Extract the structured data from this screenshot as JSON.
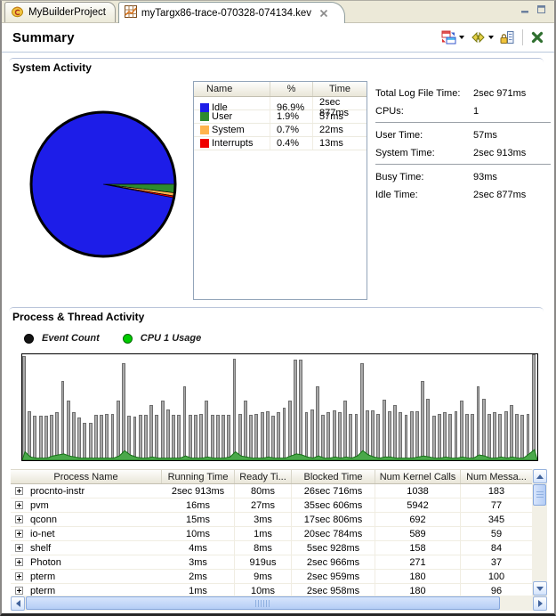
{
  "window": {
    "buttons": [
      "minimize",
      "maximize"
    ]
  },
  "tabs": [
    {
      "label": "MyBuilderProject",
      "icon": "builder-project-icon",
      "active": false
    },
    {
      "label": "myTargx86-trace-070328-074134.kev",
      "icon": "trace-file-icon",
      "active": true,
      "closable": true
    }
  ],
  "header": {
    "title": "Summary",
    "toolbar_icons": [
      "pane-layout-icon",
      "sync-panes-icon",
      "lock-columns-icon",
      "close-icon"
    ]
  },
  "system_activity": {
    "title": "System Activity",
    "table": {
      "headers": [
        "Name",
        "%",
        "Time"
      ],
      "rows": [
        {
          "name": "Idle",
          "color": "#1d1de8",
          "percent": "96.9%",
          "time": "2sec 877ms"
        },
        {
          "name": "User",
          "color": "#2e8b2e",
          "percent": "1.9%",
          "time": "57ms"
        },
        {
          "name": "System",
          "color": "#ffb44d",
          "percent": "0.7%",
          "time": "22ms"
        },
        {
          "name": "Interrupts",
          "color": "#f00000",
          "percent": "0.4%",
          "time": "13ms"
        }
      ]
    },
    "stats": [
      {
        "label": "Total Log File Time:",
        "value": "2sec 971ms"
      },
      {
        "label": "CPUs:",
        "value": "1",
        "divider_after": true
      },
      {
        "label": "User Time:",
        "value": "57ms"
      },
      {
        "label": "System Time:",
        "value": "2sec 913ms",
        "divider_after": true
      },
      {
        "label": "Busy Time:",
        "value": "93ms"
      },
      {
        "label": "Idle Time:",
        "value": "2sec 877ms"
      }
    ]
  },
  "process_activity": {
    "title": "Process & Thread Activity",
    "legend": [
      {
        "label": "Event Count",
        "color": "#111111"
      },
      {
        "label": "CPU 1 Usage",
        "color": "#00cc00"
      }
    ],
    "table": {
      "headers": [
        "Process Name",
        "Running Time",
        "Ready Ti...",
        "Blocked Time",
        "Num Kernel Calls",
        "Num Messa..."
      ],
      "rows": [
        [
          "procnto-instr",
          "2sec 913ms",
          "80ms",
          "26sec 716ms",
          "1038",
          "183"
        ],
        [
          "pvm",
          "16ms",
          "27ms",
          "35sec 606ms",
          "5942",
          "77"
        ],
        [
          "qconn",
          "15ms",
          "3ms",
          "17sec 806ms",
          "692",
          "345"
        ],
        [
          "io-net",
          "10ms",
          "1ms",
          "20sec 784ms",
          "589",
          "59"
        ],
        [
          "shelf",
          "4ms",
          "8ms",
          "5sec 928ms",
          "158",
          "84"
        ],
        [
          "Photon",
          "3ms",
          "919us",
          "2sec 966ms",
          "271",
          "37"
        ],
        [
          "pterm",
          "2ms",
          "9ms",
          "2sec 959ms",
          "180",
          "100"
        ],
        [
          "pterm",
          "1ms",
          "10ms",
          "2sec 958ms",
          "180",
          "96"
        ]
      ]
    }
  },
  "chart_data": [
    {
      "type": "pie",
      "title": "System Activity",
      "start_angle_deg": 0,
      "direction": "clockwise",
      "slices": [
        {
          "label": "User",
          "value": 1.9,
          "color": "#2e8b2e"
        },
        {
          "label": "System",
          "value": 0.7,
          "color": "#ffb44d"
        },
        {
          "label": "Interrupts",
          "value": 0.4,
          "color": "#f00000"
        },
        {
          "label": "Idle",
          "value": 96.9,
          "color": "#1d1de8"
        }
      ]
    },
    {
      "type": "bar",
      "title": "Process & Thread Activity",
      "ylim": [
        0,
        100
      ],
      "unit": "percent-of-chart-height",
      "legend_position": "top-left",
      "series": [
        {
          "name": "Event Count",
          "color": "#a8a8a8",
          "values": [
            98,
            46,
            42,
            42,
            42,
            43,
            45,
            75,
            56,
            45,
            40,
            35,
            35,
            43,
            43,
            44,
            44,
            56,
            92,
            42,
            41,
            43,
            43,
            52,
            43,
            56,
            48,
            43,
            43,
            70,
            43,
            43,
            44,
            56,
            43,
            43,
            43,
            43,
            96,
            44,
            56,
            43,
            44,
            45,
            46,
            42,
            45,
            50,
            56,
            95,
            95,
            45,
            48,
            70,
            43,
            45,
            47,
            45,
            56,
            44,
            44,
            92,
            47,
            47,
            44,
            57,
            46,
            52,
            45,
            43,
            46,
            46,
            75,
            58,
            42,
            44,
            45,
            44,
            46,
            56,
            44,
            44,
            70,
            58,
            44,
            45,
            44,
            46,
            52,
            44,
            43,
            44,
            100
          ]
        },
        {
          "name": "CPU 1 Usage",
          "color": "#33aa33",
          "values": [
            8,
            3,
            2,
            2,
            2,
            4,
            5,
            6,
            4,
            3,
            2,
            2,
            2,
            2,
            2,
            2,
            2,
            4,
            9,
            5,
            3,
            2,
            2,
            3,
            2,
            2,
            2,
            2,
            2,
            4,
            2,
            2,
            2,
            3,
            2,
            2,
            2,
            3,
            8,
            4,
            3,
            2,
            2,
            2,
            3,
            2,
            2,
            2,
            4,
            6,
            5,
            3,
            2,
            4,
            2,
            2,
            3,
            2,
            3,
            2,
            4,
            9,
            5,
            3,
            2,
            3,
            3,
            2,
            2,
            2,
            2,
            3,
            4,
            3,
            2,
            2,
            3,
            2,
            2,
            3,
            2,
            2,
            5,
            4,
            2,
            2,
            3,
            2,
            3,
            2,
            2,
            6,
            10
          ]
        }
      ]
    }
  ]
}
